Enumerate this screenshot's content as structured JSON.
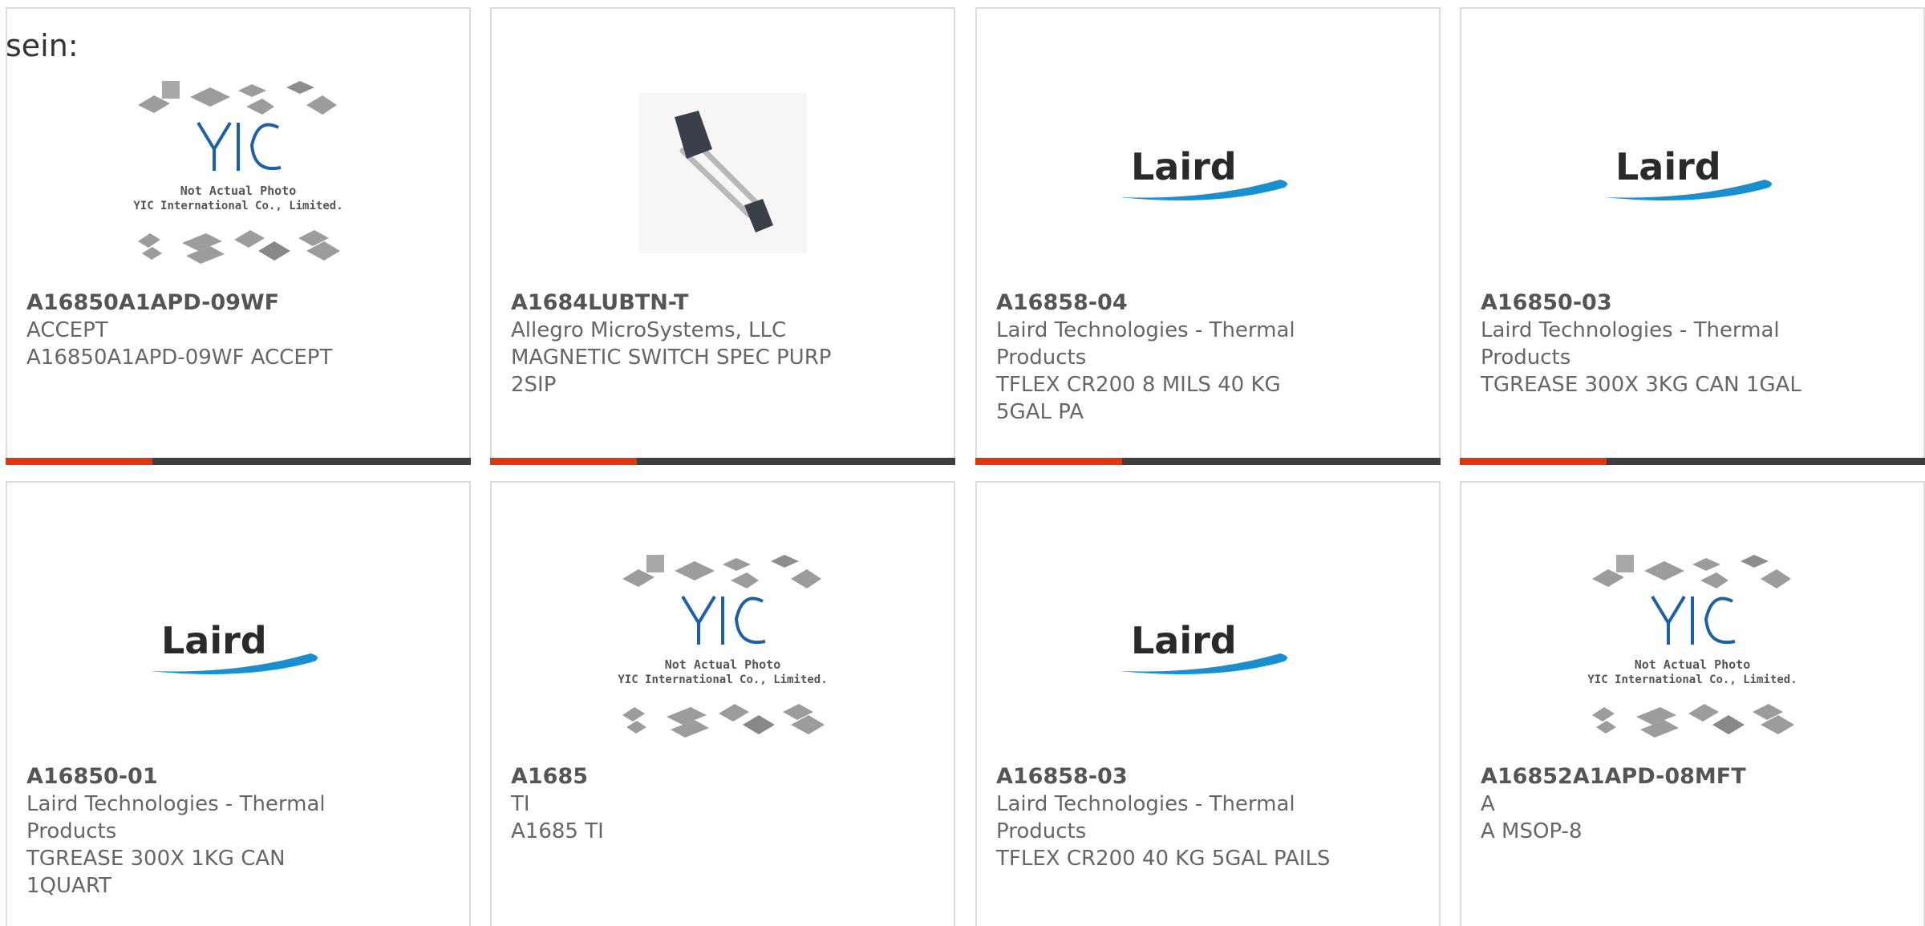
{
  "intro": "sein:",
  "products": [
    {
      "part": "A16850A1APD-09WF",
      "maker": "ACCEPT",
      "desc": "A16850A1APD-09WF ACCEPT",
      "image": "yic-placeholder",
      "image_text": [
        "Not Actual Photo",
        "YIC International Co., Limited."
      ]
    },
    {
      "part": "A1684LUBTN-T",
      "maker": "Allegro MicroSystems, LLC",
      "desc": "MAGNETIC SWITCH SPEC PURP 2SIP",
      "image": "component-photo",
      "image_text": []
    },
    {
      "part": "A16858-04",
      "maker": "Laird Technologies - Thermal Products",
      "desc": "TFLEX CR200 8 MILS 40 KG 5GAL PA",
      "image": "laird-logo",
      "image_text": [
        "Laird"
      ]
    },
    {
      "part": "A16850-03",
      "maker": "Laird Technologies - Thermal Products",
      "desc": "TGREASE 300X 3KG CAN 1GAL",
      "image": "laird-logo",
      "image_text": [
        "Laird"
      ]
    },
    {
      "part": "A16850-01",
      "maker": "Laird Technologies - Thermal Products",
      "desc": "TGREASE 300X 1KG CAN 1QUART",
      "image": "laird-logo",
      "image_text": [
        "Laird"
      ]
    },
    {
      "part": "A1685",
      "maker": "TI",
      "desc": "A1685 TI",
      "image": "yic-placeholder",
      "image_text": [
        "Not Actual Photo",
        "YIC International Co., Limited."
      ]
    },
    {
      "part": "A16858-03",
      "maker": "Laird Technologies - Thermal Products",
      "desc": "TFLEX CR200 40 KG 5GAL PAILS",
      "image": "laird-logo",
      "image_text": [
        "Laird"
      ]
    },
    {
      "part": "A16852A1APD-08MFT",
      "maker": "A",
      "desc": "A MSOP-8",
      "image": "yic-placeholder",
      "image_text": [
        "Not Actual Photo",
        "YIC International Co., Limited."
      ]
    }
  ],
  "colors": {
    "accent": "#e1340f",
    "bar": "#3e3e3e",
    "laird_blue": "#1a8fcf",
    "yic_blue": "#1f5fa8"
  }
}
